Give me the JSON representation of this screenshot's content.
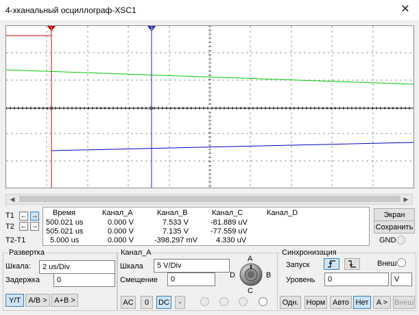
{
  "window": {
    "title": "4-хканальный осциллограф-XSC1",
    "close_icon": "close-icon"
  },
  "screen": {
    "bg": "#ffffff",
    "colors": {
      "channel_a": "#00c800",
      "channel_b": "#0000c0",
      "cursor1": "#d00000",
      "cursor2": "#2020c0"
    },
    "cursor1_label": "1",
    "cursor2_label": "2"
  },
  "readout": {
    "headers": [
      "Время",
      "Канал_A",
      "Канал_B",
      "Канал_C",
      "Канал_D"
    ],
    "rows": [
      {
        "label": "T1",
        "time": "500.021 us",
        "a": "0.000 V",
        "b": "7.533 V",
        "c": "-81.889 uV",
        "d": ""
      },
      {
        "label": "T2",
        "time": "505.021 us",
        "a": "0.000 V",
        "b": "7.135 V",
        "c": "-77.559 uV",
        "d": ""
      },
      {
        "label": "T2-T1",
        "time": "5.000 us",
        "a": "0.000 V",
        "b": "-398.297 mV",
        "c": "4.330 uV",
        "d": ""
      }
    ]
  },
  "right_buttons": {
    "screen": "Экран",
    "save": "Сохранить",
    "gnd": "GND"
  },
  "sweep": {
    "title": "Развертка",
    "scale_label": "Шкала:",
    "scale_value": "2 us/Div",
    "delay_label": "Задержка",
    "delay_value": "0",
    "modes": [
      "Y/T",
      "A/B >",
      "A+B >"
    ]
  },
  "channel": {
    "title": "Канал_A",
    "scale_label": "Шкала",
    "scale_value": "5  V/Div",
    "offset_label": "Смещение",
    "offset_value": "0",
    "coupling": [
      "AC",
      "0",
      "DC",
      "-"
    ],
    "knob_labels": {
      "a": "A",
      "b": "B",
      "c": "C",
      "d": "D"
    }
  },
  "sync": {
    "title": "Синхронизация",
    "trigger_label": "Запуск",
    "external_label": "Внеш",
    "level_label": "Уровень",
    "level_value": "0",
    "level_unit": "V",
    "modes": [
      "Одн.",
      "Норм",
      "Авто",
      "Нет",
      "A >",
      "Внеш"
    ]
  }
}
